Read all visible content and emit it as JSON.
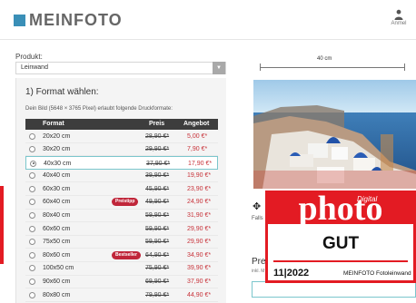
{
  "header": {
    "logo": "MEINFOTO",
    "account_label": "Anmel"
  },
  "product": {
    "label": "Produkt:",
    "selected": "Leinwand"
  },
  "format": {
    "heading": "1) Format wählen:",
    "hint": "Dein Bild (5648 × 3765 Pixel) erlaubt folgende Druckformate:",
    "columns": {
      "format": "Format",
      "price": "Preis",
      "offer": "Angebot"
    },
    "rows": [
      {
        "size": "20x20 cm",
        "price": "28,90 €*",
        "offer": "5,00 €*",
        "badge": ""
      },
      {
        "size": "30x20 cm",
        "price": "29,90 €*",
        "offer": "7,90 €*",
        "badge": ""
      },
      {
        "size": "40x30 cm",
        "price": "37,90 €*",
        "offer": "17,90 €*",
        "badge": ""
      },
      {
        "size": "40x40 cm",
        "price": "39,90 €*",
        "offer": "19,90 €*",
        "badge": ""
      },
      {
        "size": "60x30 cm",
        "price": "45,90 €*",
        "offer": "23,90 €*",
        "badge": ""
      },
      {
        "size": "60x40 cm",
        "price": "49,90 €*",
        "offer": "24,90 €*",
        "badge": "Preistipp"
      },
      {
        "size": "80x40 cm",
        "price": "59,90 €*",
        "offer": "31,90 €*",
        "badge": ""
      },
      {
        "size": "60x60 cm",
        "price": "59,90 €*",
        "offer": "29,90 €*",
        "badge": ""
      },
      {
        "size": "75x50 cm",
        "price": "59,90 €*",
        "offer": "29,90 €*",
        "badge": ""
      },
      {
        "size": "80x60 cm",
        "price": "64,90 €*",
        "offer": "34,90 €*",
        "badge": "Bestseller"
      },
      {
        "size": "100x50 cm",
        "price": "75,90 €*",
        "offer": "39,90 €*",
        "badge": ""
      },
      {
        "size": "90x60 cm",
        "price": "69,90 €*",
        "offer": "37,90 €*",
        "badge": ""
      },
      {
        "size": "80x80 cm",
        "price": "79,90 €*",
        "offer": "44,90 €*",
        "badge": ""
      }
    ],
    "selected_index": 2
  },
  "preview": {
    "width_label": "40 cm",
    "move_hint": "Falls",
    "price_heading": "Pre",
    "price_sub": "inkl. M"
  },
  "award": {
    "magazine_small": "Digital",
    "magazine_big": "photo",
    "grade": "GUT",
    "date": "11|2022",
    "product": "MEINFOTO Fotoleinwand"
  },
  "colors": {
    "accent": "#3a8fb7",
    "offer_red": "#c8333a",
    "award_red": "#e31b23",
    "selected_border": "#7bc6cc"
  }
}
